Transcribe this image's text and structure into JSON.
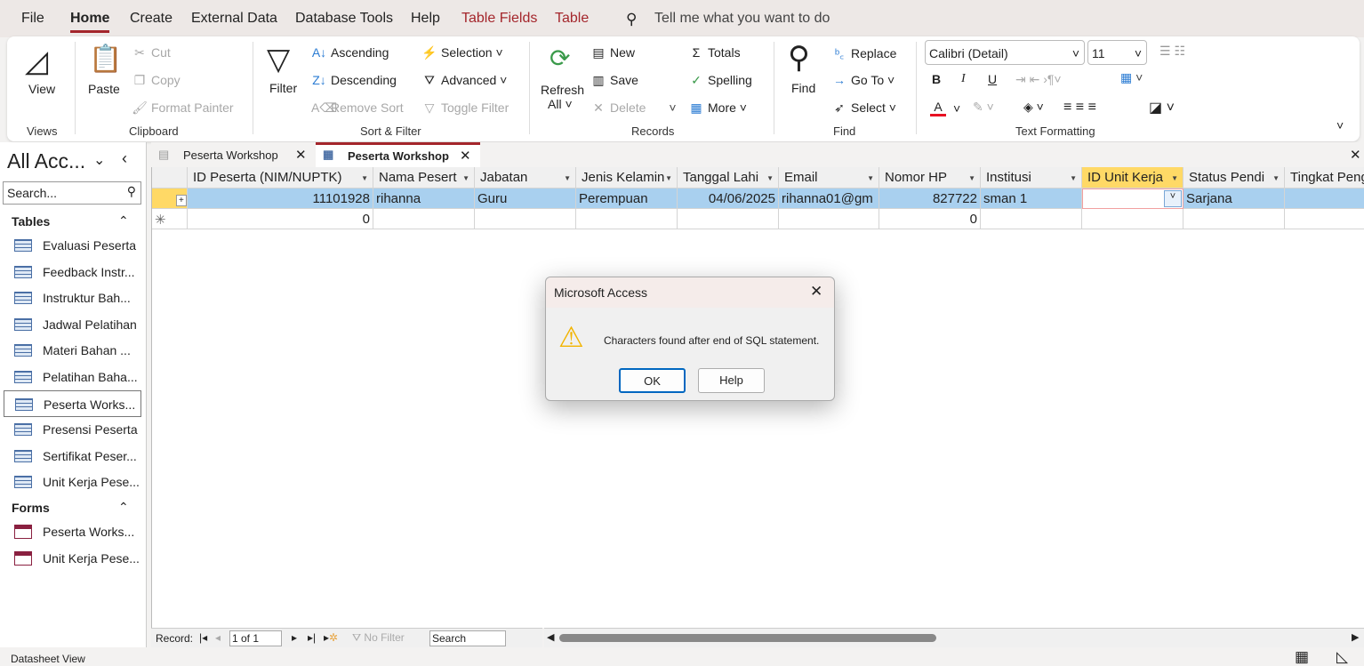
{
  "menu": {
    "file": "File",
    "home": "Home",
    "create": "Create",
    "external": "External Data",
    "dbtools": "Database Tools",
    "help": "Help",
    "table_fields": "Table Fields",
    "table": "Table",
    "tell_me": "Tell me what you want to do"
  },
  "ribbon": {
    "views": {
      "view": "View",
      "group": "Views"
    },
    "clipboard": {
      "paste": "Paste",
      "cut": "Cut",
      "copy": "Copy",
      "format_painter": "Format Painter",
      "group": "Clipboard"
    },
    "sort_filter": {
      "filter": "Filter",
      "ascending": "Ascending",
      "descending": "Descending",
      "remove_sort": "Remove Sort",
      "selection": "Selection",
      "advanced": "Advanced",
      "toggle_filter": "Toggle Filter",
      "group": "Sort & Filter"
    },
    "records": {
      "refresh": "Refresh",
      "all": "All",
      "new": "New",
      "save": "Save",
      "delete": "Delete",
      "totals": "Totals",
      "spelling": "Spelling",
      "more": "More",
      "group": "Records"
    },
    "find": {
      "find": "Find",
      "replace": "Replace",
      "goto": "Go To",
      "select": "Select",
      "group": "Find"
    },
    "text_formatting": {
      "font": "Calibri (Detail)",
      "size": "11",
      "group": "Text Formatting",
      "font_color": "#e81123"
    }
  },
  "nav": {
    "title": "All Acc...",
    "search_placeholder": "Search...",
    "tables_header": "Tables",
    "tables": [
      "Evaluasi Peserta",
      "Feedback Instr...",
      "Instruktur Bah...",
      "Jadwal Pelatihan",
      "Materi Bahan ...",
      "Pelatihan Baha...",
      "Peserta Works...",
      "Presensi Peserta",
      "Sertifikat Peser...",
      "Unit Kerja Pese..."
    ],
    "forms_header": "Forms",
    "forms": [
      "Peserta Works...",
      "Unit Kerja Pese..."
    ]
  },
  "tabs": [
    {
      "label": "Peserta Workshop"
    },
    {
      "label": "Peserta Workshop"
    }
  ],
  "grid": {
    "columns": [
      "ID Peserta (NIM/NUPTK)",
      "Nama Pesert",
      "Jabatan",
      "Jenis Kelamin",
      "Tanggal Lahi",
      "Email",
      "Nomor HP",
      "Institusi",
      "ID Unit Kerja",
      "Status Pendi",
      "Tingkat Peng"
    ],
    "row1": [
      "11101928",
      "rihanna",
      "Guru",
      "Perempuan",
      "04/06/2025",
      "rihanna01@gm",
      "827722",
      "sman 1",
      "",
      "Sarjana",
      ""
    ],
    "newrow": [
      "0",
      "",
      "",
      "",
      "",
      "",
      "0",
      "",
      "",
      "",
      ""
    ]
  },
  "recnav": {
    "label": "Record:",
    "position": "1 of 1",
    "no_filter": "No Filter",
    "search": "Search"
  },
  "dialog": {
    "title": "Microsoft Access",
    "message": "Characters found after end of SQL statement.",
    "ok": "OK",
    "help": "Help"
  },
  "status": {
    "view": "Datasheet View"
  }
}
